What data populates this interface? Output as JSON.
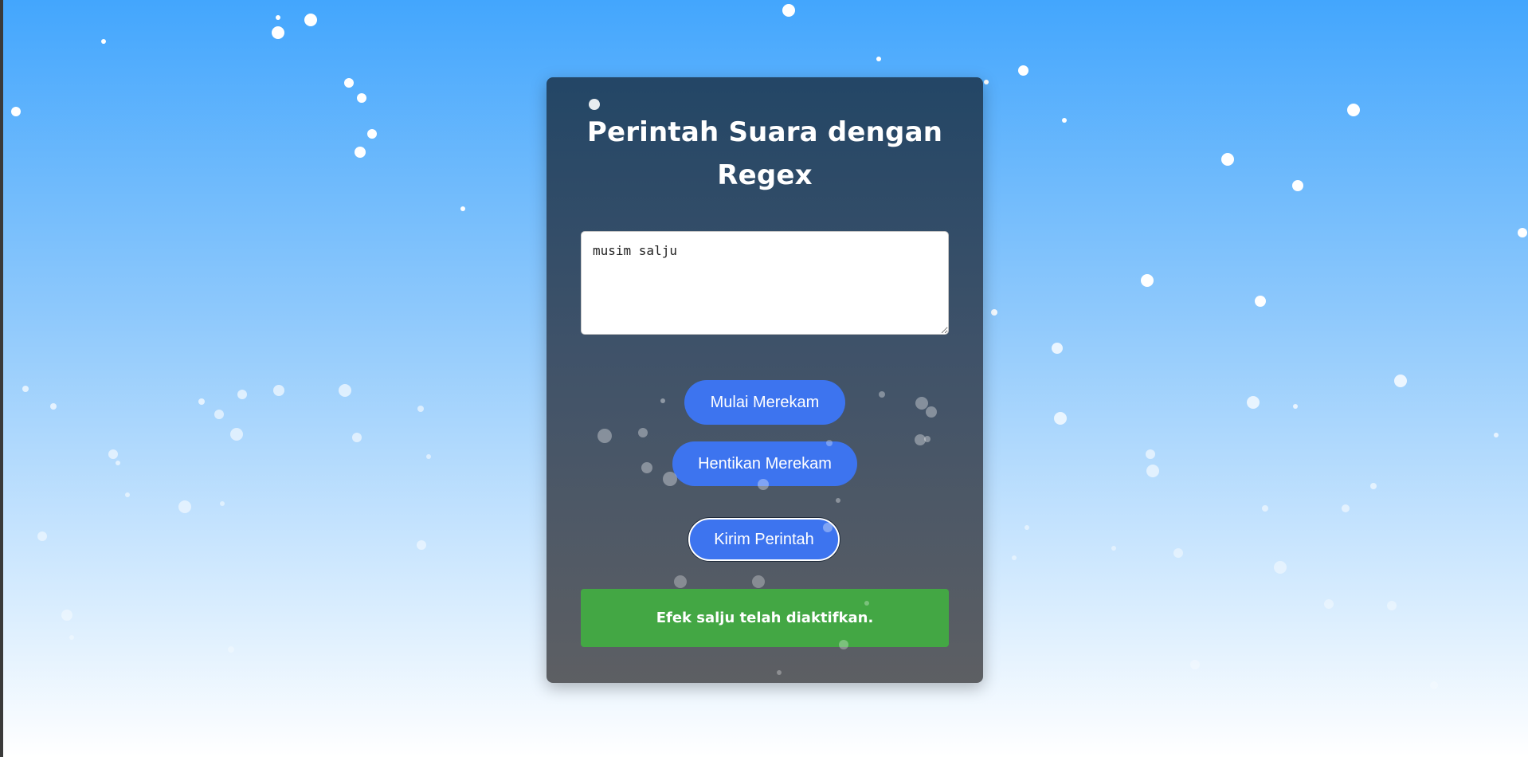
{
  "app": {
    "title": "Perintah Suara dengan Regex"
  },
  "command_input": {
    "value": "musim salju"
  },
  "buttons": {
    "start_label": "Mulai Merekam",
    "stop_label": "Hentikan Merekam",
    "send_label": "Kirim Perintah"
  },
  "status": {
    "message": "Efek salju telah diaktifkan."
  },
  "colors": {
    "button": "#3d74ef",
    "status_success": "#43a744",
    "card_top": "#234666",
    "card_bottom": "#5d5f63"
  }
}
